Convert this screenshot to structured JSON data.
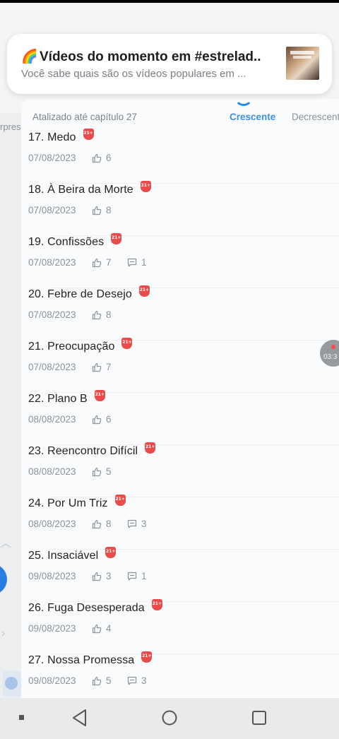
{
  "notification": {
    "title": "Vídeos do momento em #estrelad..",
    "body": "Você sabe quais são os vídeos populares em ...",
    "icon": "rainbow-cloud-emoji",
    "icon_char": "🌈"
  },
  "sidebar_peek": {
    "text": "rpres"
  },
  "sort_bar": {
    "updated_label": "Atalizado até capítulo 27",
    "ascending_label": "Crescente",
    "descending_label": "Decrescente"
  },
  "record_button": {
    "time": "03:3"
  },
  "colors": {
    "accent": "#3d8fe0",
    "badge": "#e94b4b",
    "record_dot": "#ff3b3b"
  },
  "chapters": [
    {
      "title": "17. Medo",
      "badge": "21+",
      "date": "07/08/2023",
      "likes": "6",
      "comments": ""
    },
    {
      "title": "18. À Beira da Morte",
      "badge": "21+",
      "date": "07/08/2023",
      "likes": "8",
      "comments": ""
    },
    {
      "title": "19. Confissões",
      "badge": "21+",
      "date": "07/08/2023",
      "likes": "7",
      "comments": "1"
    },
    {
      "title": "20. Febre de Desejo",
      "badge": "21+",
      "date": "07/08/2023",
      "likes": "8",
      "comments": ""
    },
    {
      "title": "21. Preocupação",
      "badge": "21+",
      "date": "07/08/2023",
      "likes": "7",
      "comments": ""
    },
    {
      "title": "22. Plano B",
      "badge": "21+",
      "date": "08/08/2023",
      "likes": "6",
      "comments": ""
    },
    {
      "title": "23. Reencontro Difícil",
      "badge": "21+",
      "date": "08/08/2023",
      "likes": "5",
      "comments": ""
    },
    {
      "title": "24. Por Um Triz",
      "badge": "21+",
      "date": "08/08/2023",
      "likes": "8",
      "comments": "3"
    },
    {
      "title": "25. Insaciável",
      "badge": "21+",
      "date": "09/08/2023",
      "likes": "3",
      "comments": "1"
    },
    {
      "title": "26. Fuga Desesperada",
      "badge": "21+",
      "date": "09/08/2023",
      "likes": "4",
      "comments": ""
    },
    {
      "title": "27. Nossa Promessa",
      "badge": "21+",
      "date": "09/08/2023",
      "likes": "5",
      "comments": "3"
    }
  ],
  "nav_bar": {
    "buttons": [
      "menu-square-icon",
      "back-triangle-icon",
      "home-circle-icon",
      "recents-square-icon"
    ]
  }
}
